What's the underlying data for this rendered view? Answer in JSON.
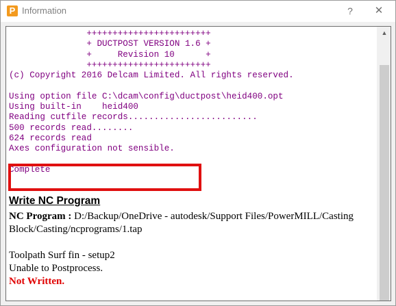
{
  "window": {
    "title": "Information",
    "app_icon_letter": "P",
    "help_glyph": "?",
    "close_glyph": "✕"
  },
  "log_lines": [
    "               ++++++++++++++++++++++++",
    "               + DUCTPOST VERSION 1.6 +",
    "               +     Revision 10      +",
    "               ++++++++++++++++++++++++",
    "(c) Copyright 2016 Delcam Limited. All rights reserved.",
    "",
    "Using option file C:\\dcam\\config\\ductpost\\heid400.opt",
    "Using built-in    heid400",
    "Reading cutfile records.........................",
    "500 records read........",
    "624 records read",
    "Axes configuration not sensible.",
    "",
    "Complete"
  ],
  "output": {
    "heading": "Write NC Program",
    "nc_program_label": "NC Program :",
    "nc_program_path": " D:/Backup/OneDrive - autodesk/Support Files/PowerMILL/Casting Block/Casting/ncprograms/1.tap",
    "toolpath_line": "Toolpath Surf fin - setup2",
    "unable_line": "Unable to Postprocess.",
    "not_written": "Not Written."
  },
  "colors": {
    "log_text": "#800080",
    "highlight": "#e01010",
    "not_written": "#e00000",
    "app_icon": "#f39a1e"
  },
  "icons": {
    "app": "powermill-app-icon",
    "help": "help-icon",
    "close": "close-icon",
    "scroll_up": "scroll-up-arrow-icon"
  }
}
